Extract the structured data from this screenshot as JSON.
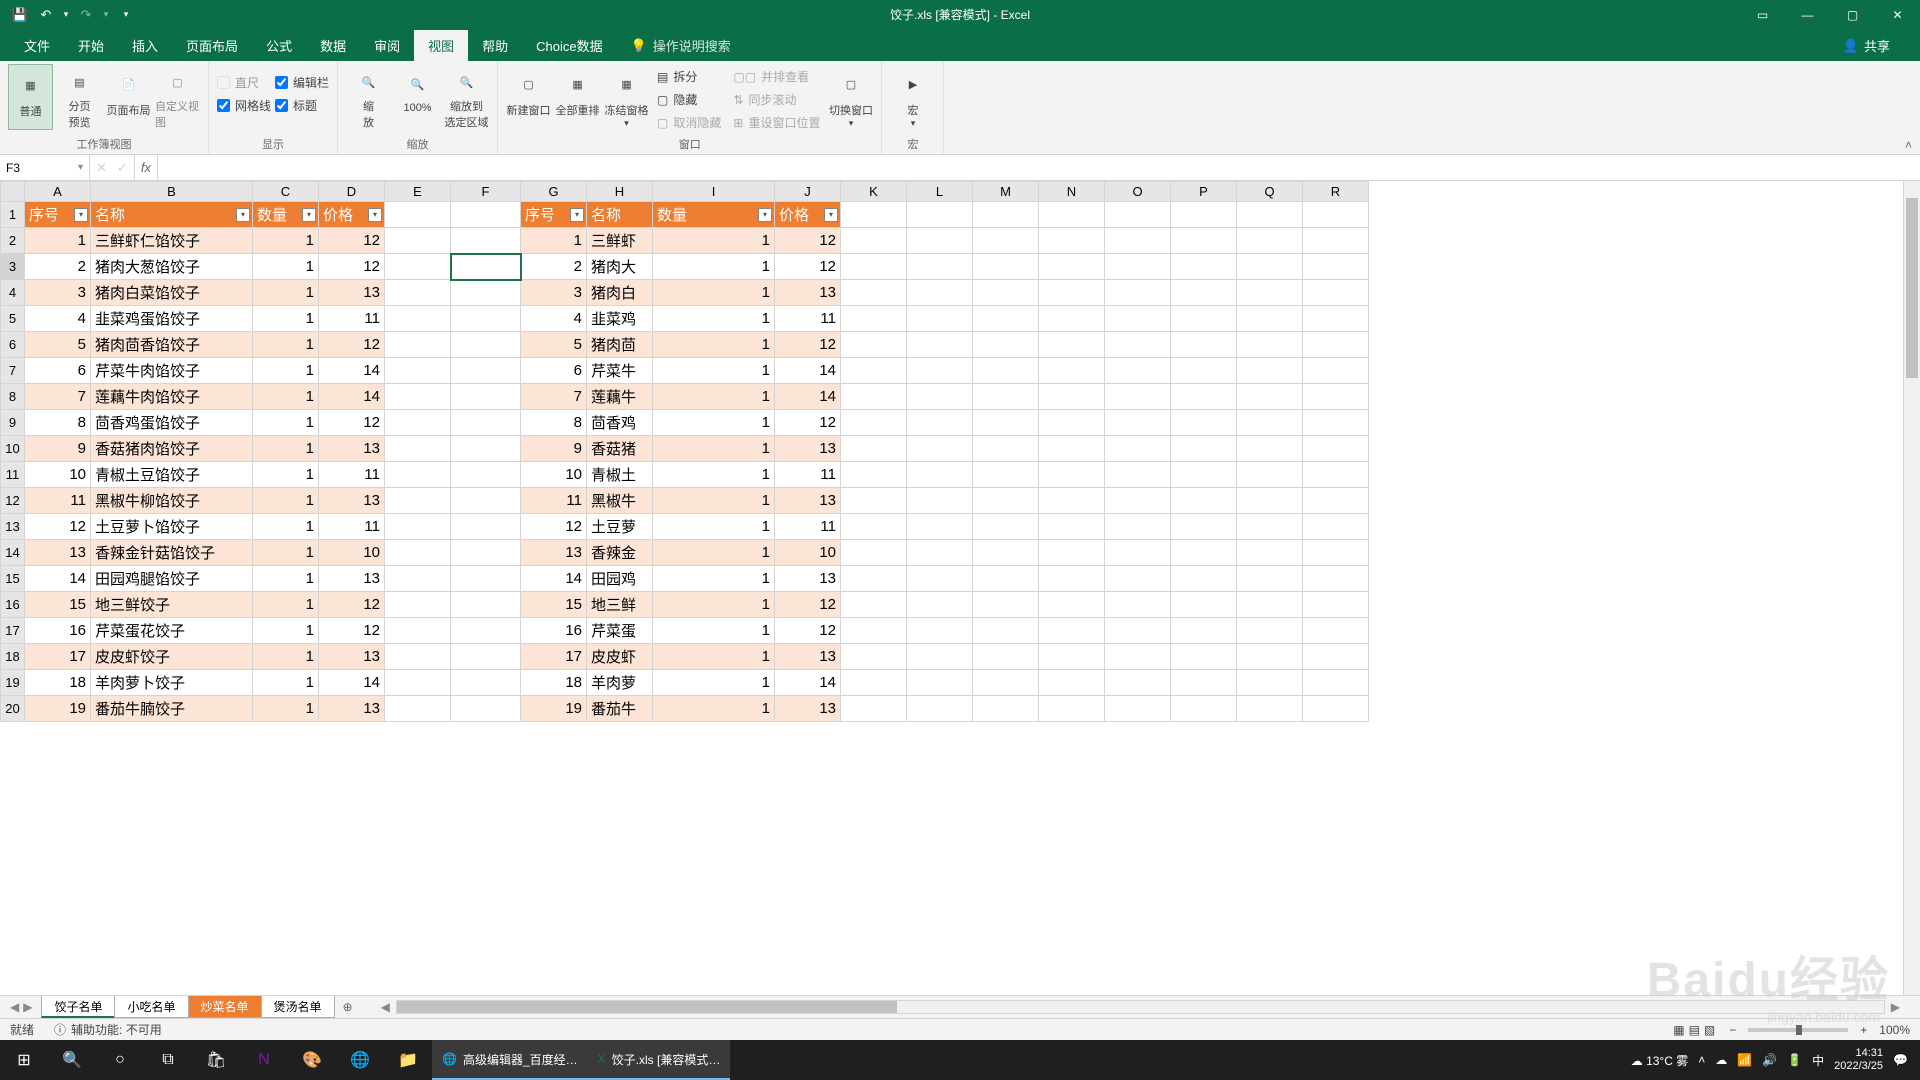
{
  "app": {
    "title": "饺子.xls  [兼容模式]  -  Excel"
  },
  "qat": {
    "save": "💾",
    "undo": "↶",
    "redo": "↷",
    "more": "▾"
  },
  "win": {
    "ribbon_opts": "▭",
    "min": "—",
    "max": "▢",
    "close": "✕"
  },
  "tabs": {
    "file": "文件",
    "home": "开始",
    "insert": "插入",
    "layout": "页面布局",
    "formulas": "公式",
    "data": "数据",
    "review": "审阅",
    "view": "视图",
    "help": "帮助",
    "choice": "Choice数据",
    "tellme": "操作说明搜索",
    "share": "共享"
  },
  "ribbon": {
    "views": {
      "normal": "普通",
      "pagebreak": "分页\n预览",
      "pagelayout": "页面布局",
      "custom": "自定义视图",
      "group": "工作簿视图"
    },
    "show": {
      "ruler": "直尺",
      "formula_bar": "编辑栏",
      "gridlines": "网格线",
      "headings": "标题",
      "group": "显示"
    },
    "zoom": {
      "zoom": "缩\n放",
      "z100": "100%",
      "zoom_sel": "缩放到\n选定区域",
      "group": "缩放"
    },
    "window": {
      "new": "新建窗口",
      "arrange": "全部重排",
      "freeze": "冻结窗格",
      "split": "拆分",
      "hide": "隐藏",
      "unhide": "取消隐藏",
      "side": "并排查看",
      "sync": "同步滚动",
      "reset": "重设窗口位置",
      "switch": "切换窗口",
      "group": "窗口"
    },
    "macros": {
      "macros": "宏",
      "group": "宏"
    }
  },
  "formula": {
    "cell": "F3",
    "value": ""
  },
  "columns": [
    "A",
    "B",
    "C",
    "D",
    "E",
    "F",
    "G",
    "H",
    "I",
    "J",
    "K",
    "L",
    "M",
    "N",
    "O",
    "P",
    "Q",
    "R"
  ],
  "headers1": {
    "seq": "序号",
    "name": "名称",
    "qty": "数量",
    "price": "价格"
  },
  "rows": [
    {
      "n": 1,
      "name": "三鲜虾仁馅饺子",
      "q": 1,
      "p": 12,
      "name2": "三鲜虾"
    },
    {
      "n": 2,
      "name": "猪肉大葱馅饺子",
      "q": 1,
      "p": 12,
      "name2": "猪肉大"
    },
    {
      "n": 3,
      "name": "猪肉白菜馅饺子",
      "q": 1,
      "p": 13,
      "name2": "猪肉白"
    },
    {
      "n": 4,
      "name": "韭菜鸡蛋馅饺子",
      "q": 1,
      "p": 11,
      "name2": "韭菜鸡"
    },
    {
      "n": 5,
      "name": "猪肉茴香馅饺子",
      "q": 1,
      "p": 12,
      "name2": "猪肉茴"
    },
    {
      "n": 6,
      "name": "芹菜牛肉馅饺子",
      "q": 1,
      "p": 14,
      "name2": "芹菜牛"
    },
    {
      "n": 7,
      "name": "莲藕牛肉馅饺子",
      "q": 1,
      "p": 14,
      "name2": "莲藕牛"
    },
    {
      "n": 8,
      "name": "茴香鸡蛋馅饺子",
      "q": 1,
      "p": 12,
      "name2": "茴香鸡"
    },
    {
      "n": 9,
      "name": "香菇猪肉馅饺子",
      "q": 1,
      "p": 13,
      "name2": "香菇猪"
    },
    {
      "n": 10,
      "name": "青椒土豆馅饺子",
      "q": 1,
      "p": 11,
      "name2": "青椒土"
    },
    {
      "n": 11,
      "name": "黑椒牛柳馅饺子",
      "q": 1,
      "p": 13,
      "name2": "黑椒牛"
    },
    {
      "n": 12,
      "name": "土豆萝卜馅饺子",
      "q": 1,
      "p": 11,
      "name2": "土豆萝"
    },
    {
      "n": 13,
      "name": "香辣金针菇馅饺子",
      "q": 1,
      "p": 10,
      "name2": "香辣金"
    },
    {
      "n": 14,
      "name": "田园鸡腿馅饺子",
      "q": 1,
      "p": 13,
      "name2": "田园鸡"
    },
    {
      "n": 15,
      "name": "地三鲜饺子",
      "q": 1,
      "p": 12,
      "name2": "地三鲜"
    },
    {
      "n": 16,
      "name": "芹菜蛋花饺子",
      "q": 1,
      "p": 12,
      "name2": "芹菜蛋"
    },
    {
      "n": 17,
      "name": "皮皮虾饺子",
      "q": 1,
      "p": 13,
      "name2": "皮皮虾"
    },
    {
      "n": 18,
      "name": "羊肉萝卜饺子",
      "q": 1,
      "p": 14,
      "name2": "羊肉萝"
    },
    {
      "n": 19,
      "name": "番茄牛腩饺子",
      "q": 1,
      "p": 13,
      "name2": "番茄牛"
    }
  ],
  "sheets": {
    "s1": "饺子名单",
    "s2": "小吃名单",
    "s3": "炒菜名单",
    "s4": "煲汤名单"
  },
  "status": {
    "ready": "就绪",
    "acc": "辅助功能: 不可用",
    "zoom": "100%"
  },
  "taskbar": {
    "chrome": "高级编辑器_百度经…",
    "excel": "饺子.xls  [兼容模式…",
    "weather": "13°C  雾",
    "time": "14:31",
    "date": "2022/3/25",
    "ime": "中"
  },
  "watermark": {
    "main": "Baidu经验",
    "sub": "jingyan.baidu.com"
  }
}
